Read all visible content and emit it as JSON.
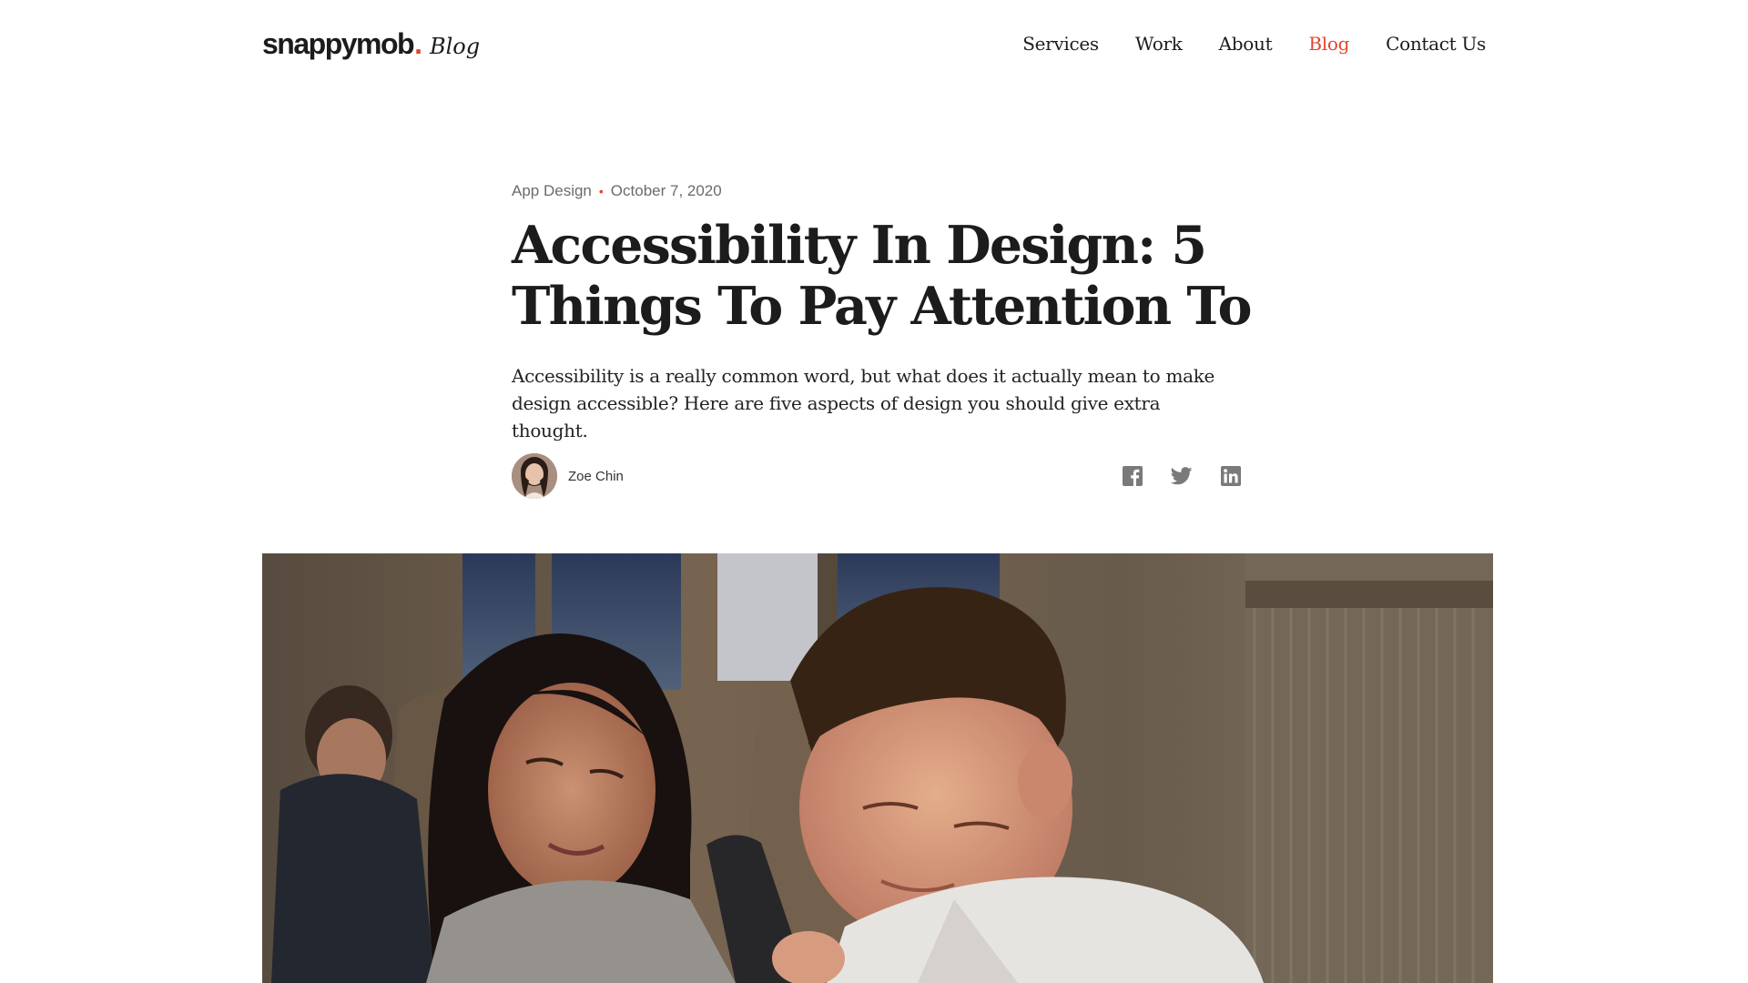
{
  "header": {
    "logo_word": "snappymob",
    "logo_dot": ".",
    "logo_suffix": "Blog",
    "nav": [
      {
        "label": "Services",
        "active": false
      },
      {
        "label": "Work",
        "active": false
      },
      {
        "label": "About",
        "active": false
      },
      {
        "label": "Blog",
        "active": true
      },
      {
        "label": "Contact Us",
        "active": false
      }
    ]
  },
  "article": {
    "category": "App Design",
    "separator": "•",
    "date": "October 7, 2020",
    "title_line1": "Accessibility In Design: 5",
    "title_line2": "Things To Pay Attention To",
    "lede": "Accessibility is a really common word, but what does it actually mean to make design accessible? Here are five aspects of design you should give extra thought.",
    "author": "Zoe Chin"
  },
  "share": {
    "icons": [
      "facebook-icon",
      "twitter-icon",
      "linkedin-icon"
    ]
  },
  "colors": {
    "accent": "#e8432e",
    "text": "#1c1c1c",
    "muted": "#6b6b6b",
    "icon": "#7a7a7a"
  }
}
